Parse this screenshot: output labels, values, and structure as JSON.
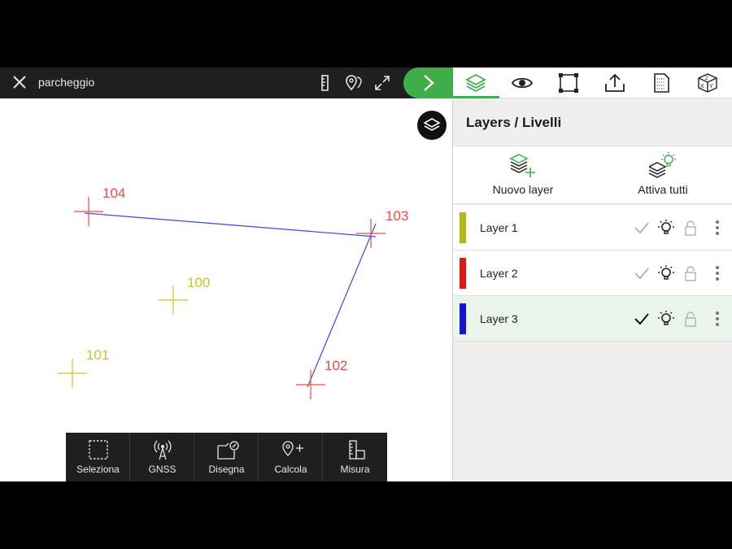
{
  "header": {
    "title": "parcheggio"
  },
  "tabs": [
    {
      "name": "tab-layers",
      "icon": "layers-icon",
      "active": true
    },
    {
      "name": "tab-view",
      "icon": "eye-icon",
      "active": false
    },
    {
      "name": "tab-selection",
      "icon": "bounding-box-icon",
      "active": false
    },
    {
      "name": "tab-export",
      "icon": "upload-icon",
      "active": false
    },
    {
      "name": "tab-document",
      "icon": "document-icon",
      "active": false
    },
    {
      "name": "tab-coordinates",
      "icon": "xyz-cube-icon",
      "active": false
    }
  ],
  "map": {
    "points": [
      {
        "id": "104",
        "color": "#e94a4a"
      },
      {
        "id": "103",
        "color": "#e94a4a"
      },
      {
        "id": "100",
        "color": "#c9c22a"
      },
      {
        "id": "101",
        "color": "#c9c22a"
      },
      {
        "id": "102",
        "color": "#e94a4a"
      }
    ],
    "line_color": "#3b47e0"
  },
  "toolbar": {
    "items": [
      {
        "label": "Seleziona"
      },
      {
        "label": "GNSS"
      },
      {
        "label": "Disegna"
      },
      {
        "label": "Calcola"
      },
      {
        "label": "Misura"
      }
    ]
  },
  "panel": {
    "title": "Layers / Livelli",
    "new_layer_label": "Nuovo layer",
    "activate_all_label": "Attiva tutti",
    "layers": [
      {
        "name": "Layer 1",
        "color": "#b5b516",
        "active": false
      },
      {
        "name": "Layer 2",
        "color": "#e81515",
        "active": false
      },
      {
        "name": "Layer 3",
        "color": "#1414d8",
        "active": true
      }
    ]
  },
  "colors": {
    "accent": "#3fae49",
    "topbar": "#1f1f1f"
  }
}
